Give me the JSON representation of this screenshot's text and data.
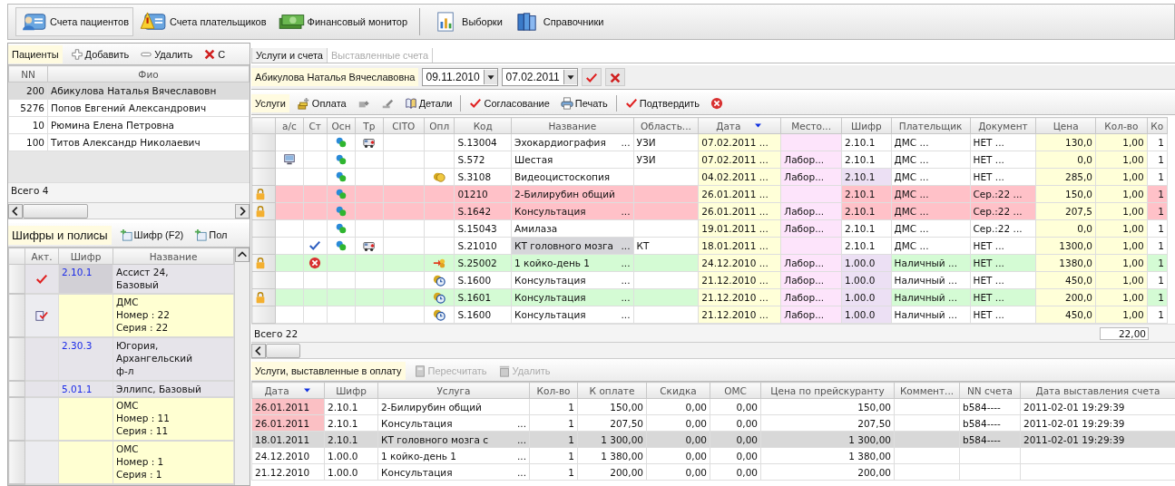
{
  "toolbar": [
    {
      "label": "Счета пациентов",
      "selected": true
    },
    {
      "label": "Счета плательщиков",
      "selected": false
    },
    {
      "label": "Финансовый монитор",
      "selected": false
    },
    {
      "label": "Выборки",
      "selected": false
    },
    {
      "label": "Справочники",
      "selected": false
    }
  ],
  "patients": {
    "tab": "Пациенты",
    "actions": [
      "Добавить",
      "Удалить",
      "С"
    ],
    "columns": [
      "NN",
      "Фио"
    ],
    "rows": [
      {
        "nn": "200",
        "name": "Абикулова Наталья Вячеславовн",
        "selected": true
      },
      {
        "nn": "5276",
        "name": "Попов Евгений Александрович",
        "selected": false
      },
      {
        "nn": "10",
        "name": "Рюмина Елена Петровна",
        "selected": false
      },
      {
        "nn": "100",
        "name": "Титов Александр Николаевич",
        "selected": false
      }
    ],
    "total": "Всего 4"
  },
  "codes": {
    "title": "Шифры и полисы",
    "actions": [
      "Шифр (F2)",
      "Пол"
    ],
    "columns": [
      "Акт.",
      "Шифр",
      "Название"
    ],
    "rows": [
      {
        "kind": "contract",
        "active": true,
        "code": "2.10.1",
        "lines": [
          "Ассист 24,",
          "Базовый"
        ],
        "selected": true
      },
      {
        "kind": "policy",
        "active": true,
        "lines": [
          "ДМС",
          "Номер : 22",
          "Серия : 22"
        ],
        "selected": false
      },
      {
        "kind": "contract",
        "active": false,
        "code": "2.30.3",
        "lines": [
          "Югория,",
          "Архангельский",
          "ф-л"
        ],
        "selected": false
      },
      {
        "kind": "contract",
        "active": false,
        "code": "5.01.1",
        "lines": [
          "Эллипс, Базовый"
        ],
        "selected": false
      },
      {
        "kind": "policy",
        "active": false,
        "lines": [
          "ОМС",
          "Номер : 11",
          "Серия : 11"
        ],
        "selected": false
      },
      {
        "kind": "policy",
        "active": false,
        "lines": [
          "ОМС",
          "Номер : 1",
          "Серия : 1"
        ],
        "selected": false
      }
    ]
  },
  "tabs": [
    {
      "label": "Услуги и счета",
      "selected": true
    },
    {
      "label": "Выставленные счета",
      "selected": false
    }
  ],
  "filter": {
    "patient": "Абикулова Наталья Вячеславовна",
    "date_from": "09.11.2010",
    "date_to": "07.02.2011"
  },
  "services": {
    "title": "Услуги",
    "actions": [
      "Оплата",
      "Детали",
      "Согласование",
      "Печать",
      "Подтвердить"
    ],
    "columns": [
      "а/с",
      "Ст",
      "Осн",
      "Тр",
      "CITO",
      "Опл",
      "Код",
      "Название",
      "Область...",
      "Дата",
      "Место...",
      "Шифр",
      "Плательщик",
      "Документ",
      "Цена",
      "Кол-во",
      "Ко"
    ],
    "rows": [
      {
        "locked": false,
        "color": "#ffffff",
        "selected": false,
        "ac": false,
        "approved": false,
        "refused": false,
        "osn": true,
        "tr": true,
        "paid": false,
        "transferred": false,
        "scheduled": false,
        "code": "S.13004",
        "name": "Эхокардиография",
        "name_more": "...",
        "area": "УЗИ",
        "date": "07.02.2011 ...",
        "shifr": "2.10.1",
        "shifr_mark": false,
        "payer": "ДМС ...",
        "doc": "НЕТ ...",
        "price": "130,0",
        "qty": "1,00",
        "k": "1"
      },
      {
        "locked": false,
        "color": "#ffffff",
        "selected": false,
        "ac": true,
        "approved": false,
        "refused": false,
        "osn": true,
        "tr": false,
        "paid": false,
        "transferred": false,
        "scheduled": false,
        "code": "S.572",
        "name": "Шестая",
        "area": "УЗИ",
        "date": "07.02.2011 ...",
        "place": "Лабор...",
        "shifr": "2.10.1",
        "shifr_mark": false,
        "payer": "ДМС ...",
        "doc": "НЕТ ...",
        "price": "0,0",
        "qty": "1,00",
        "k": "1"
      },
      {
        "locked": false,
        "color": "#ffffff",
        "selected": false,
        "ac": false,
        "approved": false,
        "refused": false,
        "osn": true,
        "tr": false,
        "paid": true,
        "transferred": false,
        "scheduled": false,
        "code": "S.3108",
        "name": "Видеоцистоскопия",
        "date": "04.02.2011 ...",
        "place": "Лабор...",
        "shifr": "2.10.1",
        "shifr_mark": true,
        "payer": "ДМС ...",
        "doc": "НЕТ ...",
        "price": "285,0",
        "qty": "1,00",
        "k": "1"
      },
      {
        "locked": true,
        "color": "#ffc1c8",
        "selected": false,
        "ac": false,
        "approved": false,
        "refused": false,
        "osn": true,
        "tr": false,
        "paid": false,
        "transferred": false,
        "scheduled": false,
        "code": "01210",
        "name": "2-Билирубин общий",
        "date": "26.01.2011 ...",
        "shifr": "2.10.1",
        "shifr_mark": false,
        "payer": "ДМС ...",
        "doc": "Сер.:22 ...",
        "price": "150,0",
        "qty": "1,00",
        "k": "1"
      },
      {
        "locked": true,
        "color": "#ffc1c8",
        "selected": false,
        "ac": false,
        "approved": false,
        "refused": false,
        "osn": true,
        "tr": false,
        "paid": false,
        "transferred": false,
        "scheduled": false,
        "code": "S.1642",
        "name": "Консультация",
        "name_more": "...",
        "date": "26.01.2011 ...",
        "place": "Лабор...",
        "shifr": "2.10.1",
        "shifr_mark": false,
        "payer": "ДМС ...",
        "doc": "Сер.:22 ...",
        "price": "207,5",
        "qty": "1,00",
        "k": "1"
      },
      {
        "locked": false,
        "color": "#ffffff",
        "selected": false,
        "ac": false,
        "approved": false,
        "refused": false,
        "osn": true,
        "tr": false,
        "paid": false,
        "transferred": false,
        "scheduled": false,
        "code": "S.15043",
        "name": "Амилаза",
        "date": "19.01.2011 ...",
        "place": "Лабор...",
        "shifr": "2.10.1",
        "shifr_mark": false,
        "payer": "ДМС ...",
        "doc": "Сер.:22 ...",
        "price": "0,0",
        "qty": "1,00",
        "k": "1"
      },
      {
        "locked": false,
        "color": "#ffffff",
        "selected": true,
        "ac": false,
        "approved": true,
        "refused": false,
        "osn": true,
        "tr": true,
        "paid": false,
        "transferred": false,
        "scheduled": false,
        "code": "S.21010",
        "name": "КТ головного мозга",
        "name_more": "...",
        "area": "КТ",
        "date": "18.01.2011 ...",
        "shifr": "2.10.1",
        "shifr_mark": false,
        "payer": "ДМС ...",
        "doc": "НЕТ ...",
        "price": "1300,0",
        "qty": "1,00",
        "k": "1"
      },
      {
        "locked": true,
        "color": "#d4fbd4",
        "selected": false,
        "ac": false,
        "approved": false,
        "refused": true,
        "osn": false,
        "tr": false,
        "paid": false,
        "transferred": true,
        "scheduled": false,
        "code": "S.25002",
        "name": "1 койко-день 1",
        "name_more": "...",
        "date": "24.12.2010 ...",
        "place": "Лабор...",
        "shifr": "1.00.0",
        "shifr_mark": true,
        "payer": "Наличный ...",
        "doc": "НЕТ ...",
        "price": "1380,0",
        "qty": "1,00",
        "k": "1"
      },
      {
        "locked": false,
        "color": "#ffffff",
        "selected": false,
        "ac": false,
        "approved": false,
        "refused": false,
        "osn": false,
        "tr": false,
        "paid": false,
        "transferred": false,
        "scheduled": true,
        "code": "S.1600",
        "name": "Консультация",
        "name_more": "...",
        "date": "21.12.2010 ...",
        "place": "Лабор...",
        "shifr": "1.00.0",
        "shifr_mark": true,
        "payer": "Наличный ...",
        "doc": "НЕТ ...",
        "price": "450,0",
        "qty": "1,00",
        "k": "1"
      },
      {
        "locked": true,
        "color": "#d4fbd4",
        "selected": false,
        "ac": false,
        "approved": false,
        "refused": false,
        "osn": false,
        "tr": false,
        "paid": false,
        "transferred": false,
        "scheduled": true,
        "code": "S.1601",
        "name": "Консультация",
        "name_more": "...",
        "date": "21.12.2010 ...",
        "place": "Лабор...",
        "shifr": "1.00.0",
        "shifr_mark": true,
        "payer": "Наличный ...",
        "doc": "НЕТ ...",
        "price": "200,0",
        "qty": "1,00",
        "k": "1"
      },
      {
        "locked": false,
        "color": "#ffffff",
        "selected": false,
        "ac": false,
        "approved": false,
        "refused": false,
        "osn": false,
        "tr": false,
        "paid": false,
        "transferred": false,
        "scheduled": true,
        "code": "S.1600",
        "name": "Консультация",
        "name_more": "...",
        "date": "21.12.2010 ...",
        "place": "Лабор...",
        "shifr": "1.00.0",
        "shifr_mark": true,
        "payer": "Наличный ...",
        "doc": "НЕТ ...",
        "price": "450,0",
        "qty": "1,00",
        "k": "1"
      }
    ],
    "total": "Всего 22",
    "qty_sum": "22,00"
  },
  "billed": {
    "title": "Услуги, выставленные в оплату",
    "actions": [
      {
        "label": "Пересчитать",
        "disabled": true
      },
      {
        "label": "Удалить",
        "disabled": true
      }
    ],
    "columns": [
      "Дата",
      "Шифр",
      "Услуга",
      "Кол-во",
      "К оплате",
      "Скидка",
      "ОМС",
      "Цена по прейскуранту",
      "Коммент...",
      "NN счета",
      "Дата выставления счета"
    ],
    "rows": [
      {
        "date": "26.01.2011",
        "flagged": true,
        "shifr": "2.10.1",
        "service": "2-Билирубин общий",
        "qty": "1",
        "pay": "150,00",
        "discount": "0,00",
        "oms": "0,00",
        "price": "150,00",
        "invoice": "b584----",
        "issued": "2011-02-01 19:29:39",
        "selected": false
      },
      {
        "date": "26.01.2011",
        "flagged": true,
        "shifr": "2.10.1",
        "service": "Консультация",
        "more": "...",
        "qty": "1",
        "pay": "207,50",
        "discount": "0,00",
        "oms": "0,00",
        "price": "207,50",
        "invoice": "b584----",
        "issued": "2011-02-01 19:29:39",
        "selected": false
      },
      {
        "date": "18.01.2011",
        "flagged": false,
        "shifr": "2.10.1",
        "service": "КТ головного мозга с",
        "more": "...",
        "qty": "1",
        "pay": "1 300,00",
        "discount": "0,00",
        "oms": "0,00",
        "price": "1 300,00",
        "invoice": "b584----",
        "issued": "2011-02-01 19:29:39",
        "selected": true
      },
      {
        "date": "24.12.2010",
        "flagged": false,
        "shifr": "1.00.0",
        "service": "1 койко-день 1",
        "more": "...",
        "qty": "1",
        "pay": "1 380,00",
        "discount": "0,00",
        "oms": "0,00",
        "price": "1 380,00",
        "selected": false
      },
      {
        "date": "21.12.2010",
        "flagged": false,
        "shifr": "1.00.0",
        "service": "Консультация",
        "more": "...",
        "qty": "1",
        "pay": "200,00",
        "discount": "0,00",
        "oms": "0,00",
        "price": "200,00",
        "selected": false
      }
    ]
  }
}
